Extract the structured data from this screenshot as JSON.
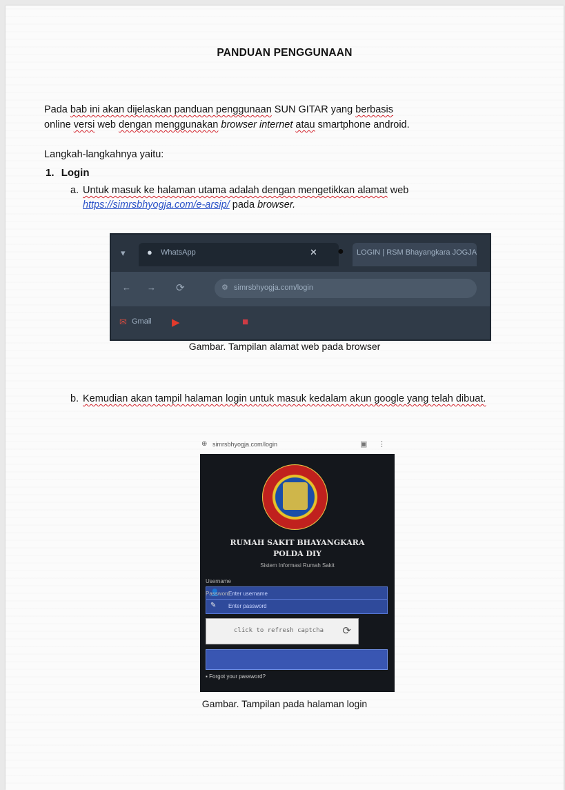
{
  "document": {
    "title": "PANDUAN PENGGUNAAN",
    "intro": {
      "p1_before": "Pada ",
      "p1_squig1": "bab ini akan dijelaskan panduan penggunaan",
      "p1_mid": " SUN GITAR yang ",
      "p1_squig2": "berbasis",
      "p1_line2_a": "online ",
      "p1_squig3": "versi",
      "p1_line2_b": " web ",
      "p1_squig4": "dengan menggunakan",
      "p1_browser": " browser internet",
      "p1_space": " ",
      "p1_squig5": "atau",
      "p1_end": " smartphone android."
    },
    "steps_intro": "Langkah-langkahnya yaitu:",
    "section": {
      "number": "1.",
      "label": "Login"
    },
    "item_a": {
      "marker": "a.",
      "text_squig": "Untuk masuk ke halaman utama adalah dengan mengetikkan alamat",
      "text_rest": " web",
      "url": "https://simrsbhyogja.com/e-arsip/",
      "text_after": " pada ",
      "text_browser": "browser."
    },
    "caption_1": "Gambar. Tampilan alamat web pada browser",
    "item_b": {
      "marker": "b.",
      "text": "Kemudian akan tampil halaman login untuk masuk kedalam akun google yang telah dibuat."
    },
    "caption_2": "Gambar. Tampilan pada halaman login"
  },
  "browser_screenshot": {
    "tab_1": "WhatsApp",
    "tab_2": "LOGIN | RSM Bhayangkara JOGJA",
    "url": "simrsbhyogja.com/login",
    "bookmark_1": "Gmail"
  },
  "login_screenshot": {
    "status_url": "simrsbhyogja.com/login",
    "hospital_line1": "RUMAH SAKIT BHAYANGKARA",
    "hospital_line2": "POLDA DIY",
    "subtitle": "Sistem Informasi Rumah Sakit",
    "username_label": "Username",
    "username_placeholder": "Enter username",
    "password_label": "Password",
    "password_placeholder": "Enter password",
    "captcha_text": "click to refresh captcha",
    "forgot_text": "Forgot your password?"
  },
  "colors": {
    "link": "#2b52c8",
    "spellcheck": "#d3212a",
    "phone_bg": "#14171c",
    "field_bg": "#2f4a9b"
  }
}
